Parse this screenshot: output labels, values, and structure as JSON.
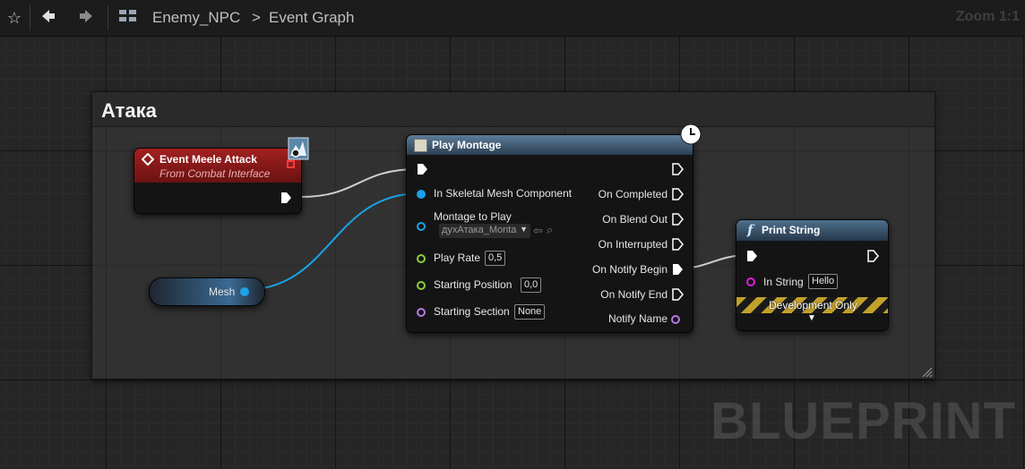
{
  "toolbar": {
    "breadcrumb": {
      "blueprint": "Enemy_NPC",
      "separator": ">",
      "graph": "Event Graph"
    },
    "zoom": "Zoom 1:1"
  },
  "comment": {
    "title": "Атака"
  },
  "event_node": {
    "title": "Event Meele Attack",
    "subtitle": "From Combat Interface"
  },
  "mesh_node": {
    "label": "Mesh"
  },
  "montage_node": {
    "title": "Play Montage",
    "inputs": {
      "skeletal_mesh": "In Skeletal Mesh Component",
      "montage_to_play": "Montage to Play",
      "montage_value": "духАтака_Monta",
      "play_rate": "Play Rate",
      "play_rate_value": "0,5",
      "starting_position": "Starting Position",
      "starting_position_value": "0,0",
      "starting_section": "Starting Section",
      "starting_section_value": "None"
    },
    "outputs": {
      "on_completed": "On Completed",
      "on_blend_out": "On Blend Out",
      "on_interrupted": "On Interrupted",
      "on_notify_begin": "On Notify Begin",
      "on_notify_end": "On Notify End",
      "notify_name": "Notify Name"
    }
  },
  "print_node": {
    "title": "Print String",
    "in_string": "In String",
    "in_string_value": "Hello",
    "dev_only": "Development Only"
  },
  "watermark": "BLUEPRINT",
  "colors": {
    "event_header": "#8b1b1b",
    "function_header": "#3f5a72",
    "object_pin": "#1aa3e8",
    "float_pin": "#8ccf3c",
    "name_pin": "#b57be0",
    "string_pin": "#e21ce2"
  }
}
